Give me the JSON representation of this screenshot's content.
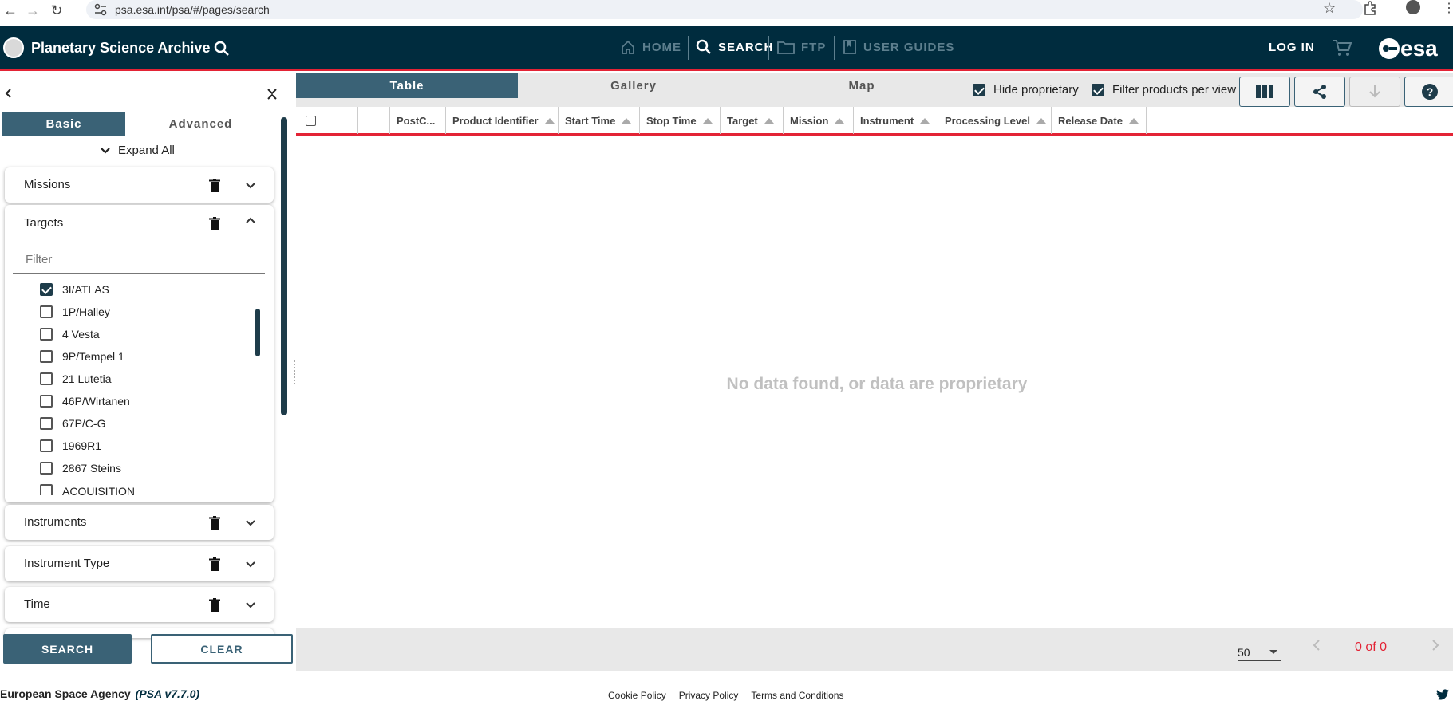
{
  "browser": {
    "url": "psa.esa.int/psa/#/pages/search"
  },
  "header": {
    "title": "Planetary Science Archive",
    "nav": {
      "home": "HOME",
      "search": "SEARCH",
      "ftp": "FTP",
      "user_guides": "USER GUIDES"
    },
    "login": "LOG IN",
    "esa_logo": "esa"
  },
  "sidebar": {
    "tabs": {
      "basic": "Basic",
      "advanced": "Advanced"
    },
    "expand_all": "Expand All",
    "panels": {
      "missions": "Missions",
      "targets": "Targets",
      "instruments": "Instruments",
      "instrument_type": "Instrument Type",
      "time": "Time"
    },
    "targets_filter_placeholder": "Filter",
    "targets_list": [
      {
        "label": "3I/ATLAS",
        "checked": true
      },
      {
        "label": "1P/Halley",
        "checked": false
      },
      {
        "label": "4 Vesta",
        "checked": false
      },
      {
        "label": "9P/Tempel 1",
        "checked": false
      },
      {
        "label": "21 Lutetia",
        "checked": false
      },
      {
        "label": "46P/Wirtanen",
        "checked": false
      },
      {
        "label": "67P/C-G",
        "checked": false
      },
      {
        "label": "1969R1",
        "checked": false
      },
      {
        "label": "2867 Steins",
        "checked": false
      },
      {
        "label": "ACQUISITION",
        "checked": false
      }
    ],
    "search_button": "SEARCH",
    "clear_button": "CLEAR"
  },
  "main": {
    "view_tabs": {
      "table": "Table",
      "gallery": "Gallery",
      "map": "Map"
    },
    "hide_proprietary": {
      "label": "Hide proprietary",
      "checked": true
    },
    "filter_per_view": {
      "label": "Filter products per view",
      "checked": true
    },
    "columns": [
      "PostC...",
      "Product Identifier",
      "Start Time",
      "Stop Time",
      "Target",
      "Mission",
      "Instrument",
      "Processing Level",
      "Release Date"
    ],
    "empty_message": "No data found, or data are proprietary",
    "page_size": "50",
    "page_count": "0 of 0"
  },
  "footer": {
    "agency": "European Space Agency",
    "version": "(PSA v7.7.0)",
    "links": {
      "cookie": "Cookie Policy",
      "privacy": "Privacy Policy",
      "terms": "Terms and Conditions"
    }
  },
  "colors": {
    "header_bg": "#002c3e",
    "accent_red": "#e32335",
    "active_tab": "#3a6276",
    "nav_inactive": "#5d7f8e"
  }
}
